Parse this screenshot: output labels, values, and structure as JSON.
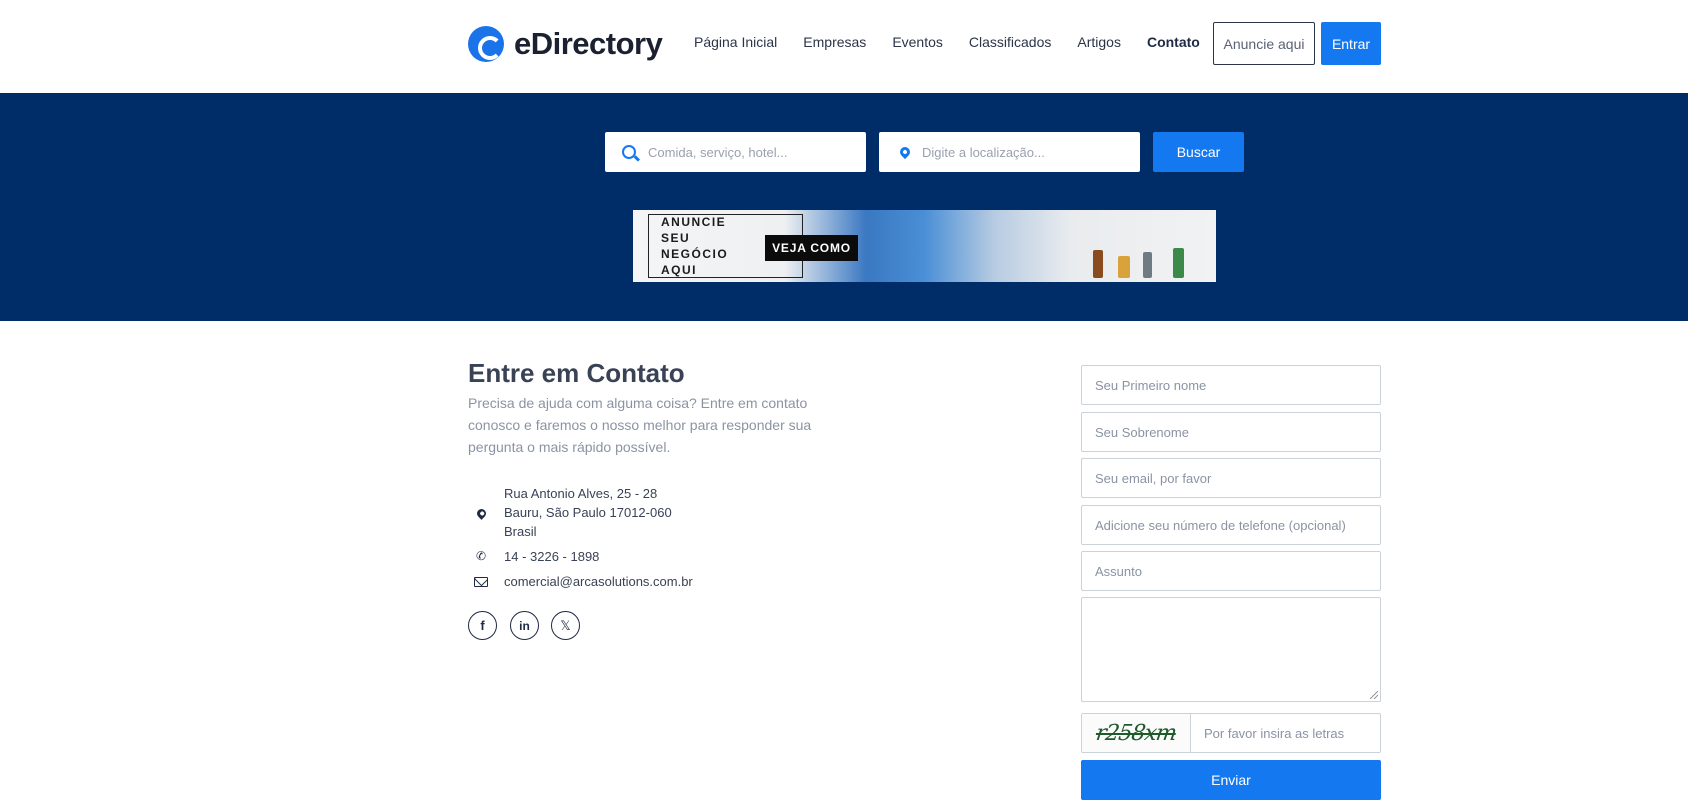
{
  "brand": {
    "name": "eDirectory",
    "color": "#1479f0",
    "icon": "edirectory-logo-icon"
  },
  "nav": {
    "items": [
      {
        "label": "Página Inicial"
      },
      {
        "label": "Empresas"
      },
      {
        "label": "Eventos"
      },
      {
        "label": "Classificados"
      },
      {
        "label": "Artigos"
      },
      {
        "label": "Contato",
        "active": true
      }
    ],
    "advertise_label": "Anuncie aqui",
    "login_label": "Entrar"
  },
  "search": {
    "keyword_placeholder": "Comida, serviço, hotel...",
    "location_placeholder": "Digite a localização...",
    "button_label": "Buscar",
    "hero_color": "#002d68"
  },
  "banner": {
    "lines": [
      "ANUNCIE",
      "SEU",
      "NEGÓCIO",
      "AQUI"
    ],
    "cta": "VEJA COMO"
  },
  "contact": {
    "title": "Entre em Contato",
    "description": "Precisa de ajuda com alguma coisa? Entre em contato conosco e faremos o nosso melhor para responder sua pergunta o mais rápido possível.",
    "address": [
      "Rua Antonio Alves, 25 - 28",
      "Bauru, São Paulo 17012-060",
      "Brasil"
    ],
    "phone": "14 - 3226 - 1898",
    "email": "comercial@arcasolutions.com.br",
    "social": [
      {
        "icon": "facebook-icon",
        "glyph": "f"
      },
      {
        "icon": "linkedin-icon",
        "glyph": "in"
      },
      {
        "icon": "x-twitter-icon",
        "glyph": "𝕏"
      }
    ]
  },
  "form": {
    "first_name_placeholder": "Seu Primeiro nome",
    "last_name_placeholder": "Seu Sobrenome",
    "email_placeholder": "Seu email, por favor",
    "phone_placeholder": "Adicione seu número de telefone (opcional)",
    "subject_placeholder": "Assunto",
    "captcha_text": "r258xm",
    "captcha_placeholder": "Por favor insira as letras",
    "submit_label": "Enviar"
  }
}
